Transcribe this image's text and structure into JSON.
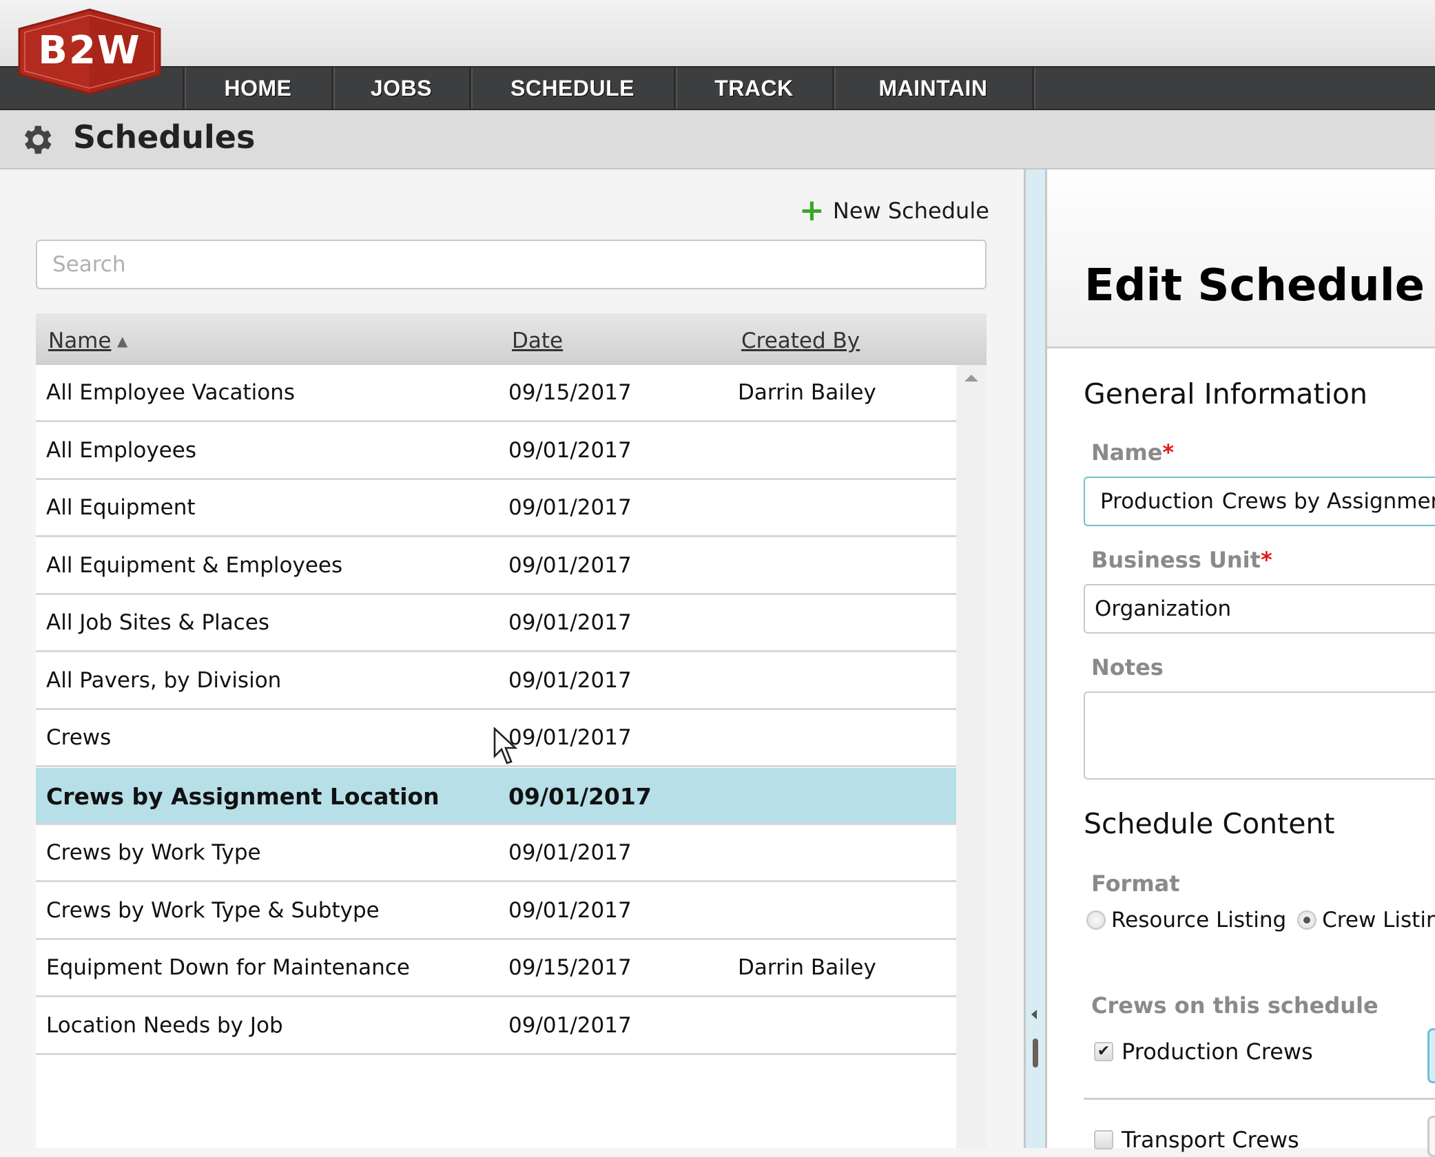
{
  "app": {
    "logo_text": "B2W",
    "brand_color": "#b32a1e"
  },
  "nav": {
    "items": [
      {
        "label": "HOME"
      },
      {
        "label": "JOBS"
      },
      {
        "label": "SCHEDULE"
      },
      {
        "label": "TRACK"
      },
      {
        "label": "MAINTAIN"
      }
    ]
  },
  "page": {
    "title": "Schedules",
    "icon": "gear-icon"
  },
  "list": {
    "new_button_label": "New Schedule",
    "search_placeholder": "Search",
    "search_value": "",
    "columns": [
      {
        "label": "Name",
        "sort": "ascending"
      },
      {
        "label": "Date"
      },
      {
        "label": "Created By"
      }
    ],
    "rows": [
      {
        "name": "All Employee Vacations",
        "date": "09/15/2017",
        "created_by": "Darrin Bailey",
        "selected": false
      },
      {
        "name": "All Employees",
        "date": "09/01/2017",
        "created_by": "",
        "selected": false
      },
      {
        "name": "All Equipment",
        "date": "09/01/2017",
        "created_by": "",
        "selected": false
      },
      {
        "name": "All Equipment & Employees",
        "date": "09/01/2017",
        "created_by": "",
        "selected": false
      },
      {
        "name": "All Job Sites & Places",
        "date": "09/01/2017",
        "created_by": "",
        "selected": false
      },
      {
        "name": "All Pavers, by Division",
        "date": "09/01/2017",
        "created_by": "",
        "selected": false
      },
      {
        "name": "Crews",
        "date": "09/01/2017",
        "created_by": "",
        "selected": false
      },
      {
        "name": "Crews by Assignment Location",
        "date": "09/01/2017",
        "created_by": "",
        "selected": true
      },
      {
        "name": "Crews by Work Type",
        "date": "09/01/2017",
        "created_by": "",
        "selected": false
      },
      {
        "name": "Crews by Work Type & Subtype",
        "date": "09/01/2017",
        "created_by": "",
        "selected": false
      },
      {
        "name": "Equipment Down for Maintenance",
        "date": "09/15/2017",
        "created_by": "Darrin Bailey",
        "selected": false
      },
      {
        "name": "Location Needs by Job",
        "date": "09/01/2017",
        "created_by": "",
        "selected": false
      }
    ],
    "selected_color": "#b6dfe8"
  },
  "editor": {
    "title": "Edit Schedule",
    "general_section": "General Information",
    "name_label": "Name",
    "name_value_before_caret": "Production ",
    "name_value_after_caret": "Crews by Assignment",
    "business_unit_label": "Business Unit",
    "business_unit_value": "Organization",
    "notes_label": "Notes",
    "notes_value": "",
    "required_marker": "*",
    "content_section": "Schedule Content",
    "format_label": "Format",
    "format_options": [
      {
        "label": "Resource Listing",
        "checked": false
      },
      {
        "label": "Crew Listing",
        "checked": true
      }
    ],
    "crews_label": "Crews on this schedule",
    "crews": [
      {
        "label": "Production Crews",
        "checked": true
      },
      {
        "label": "Transport Crews",
        "checked": false
      }
    ]
  }
}
